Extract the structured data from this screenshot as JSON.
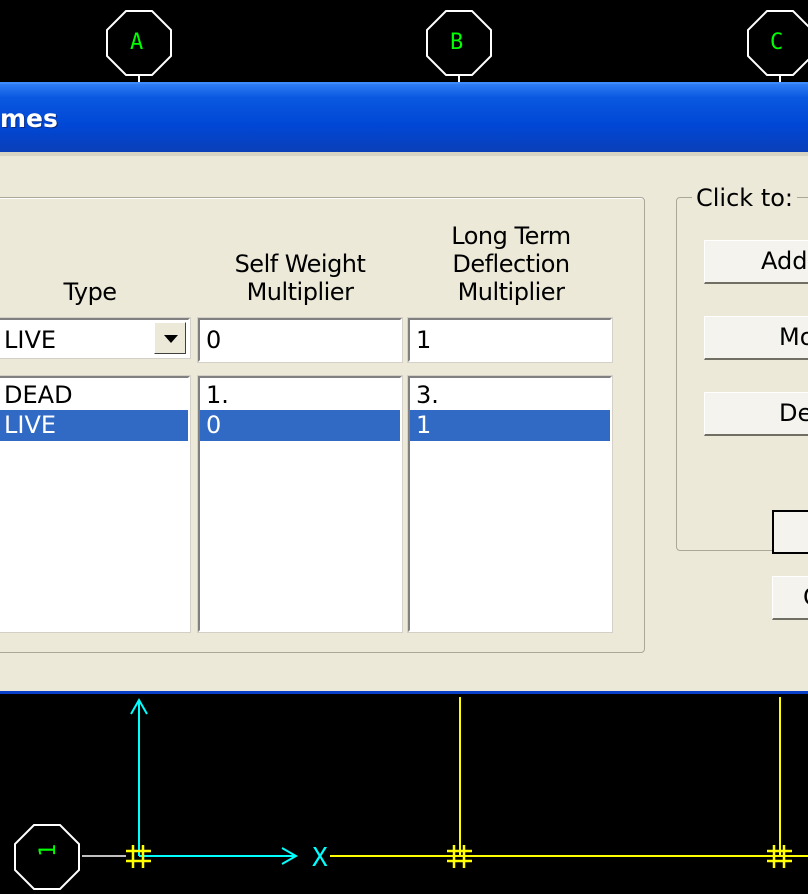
{
  "grid_bubbles": {
    "top": [
      "A",
      "B",
      "C"
    ],
    "left": [
      "1"
    ]
  },
  "axis_label": "X",
  "dialog": {
    "title_fragment": "mes",
    "headers": {
      "type": "Type",
      "self_weight": [
        "Self Weight",
        "Multiplier"
      ],
      "long_term": [
        "Long Term",
        "Deflection",
        "Multiplier"
      ]
    },
    "inputs": {
      "type_value": "LIVE",
      "self_weight_value": "0",
      "long_term_value": "1"
    },
    "rows": [
      {
        "type": "DEAD",
        "self_weight": "1.",
        "long_term": "3.",
        "selected": false
      },
      {
        "type": "LIVE",
        "self_weight": "0",
        "long_term": "1",
        "selected": true
      }
    ],
    "click_to": {
      "legend": "Click to:",
      "add_label": "Add",
      "modify_label": "Mo",
      "delete_label": "De"
    },
    "ok_label": "",
    "cancel_label": "C"
  },
  "colors": {
    "grid_bubble": "#ffffff",
    "grid_text": "#00ff00",
    "grid_line": "#ffff00",
    "axis": "#00ffff",
    "selection": "#316ac5",
    "title_bar": "#0047d6"
  }
}
